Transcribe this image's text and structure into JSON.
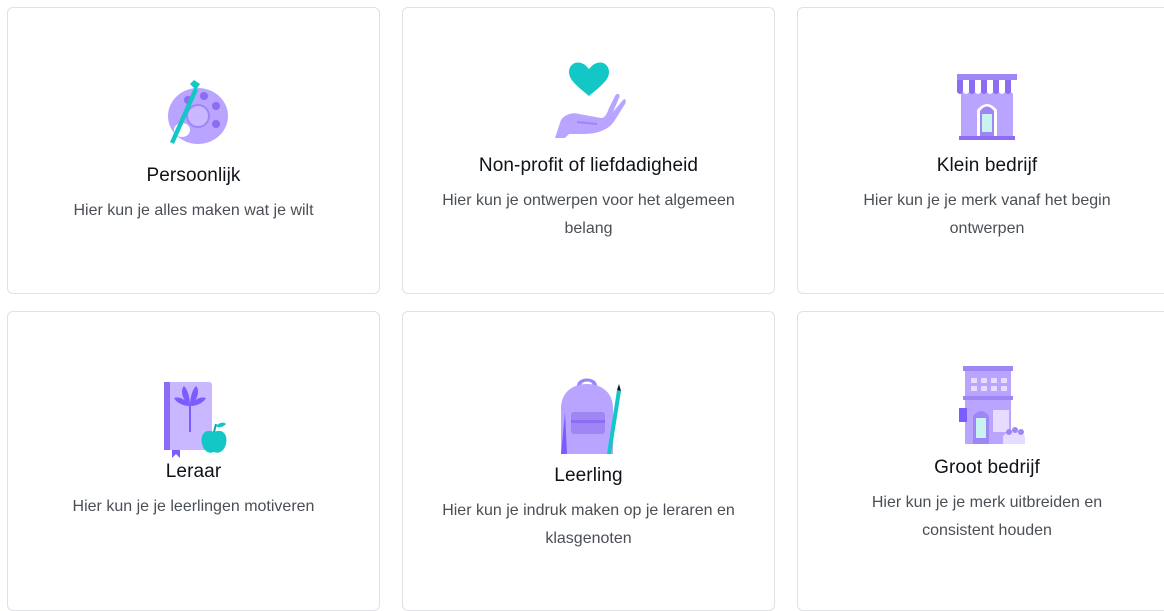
{
  "colors": {
    "purple": "#a78bfa",
    "purple_dark": "#7c5cff",
    "purple_light": "#c9b8ff",
    "teal": "#13c7c7",
    "card_border": "#dfe1e5",
    "title_text": "#0e1318",
    "desc_text": "#4a4f55"
  },
  "cards": [
    {
      "icon": "palette-icon",
      "title": "Persoonlijk",
      "description": "Hier kun je alles maken wat je wilt"
    },
    {
      "icon": "heart-hand-icon",
      "title": "Non-profit of liefdadigheid",
      "description": "Hier kun je ontwerpen voor het algemeen belang"
    },
    {
      "icon": "storefront-icon",
      "title": "Klein bedrijf",
      "description": "Hier kun je je merk vanaf het begin ontwerpen"
    },
    {
      "icon": "book-apple-icon",
      "title": "Leraar",
      "description": "Hier kun je je leerlingen motiveren"
    },
    {
      "icon": "backpack-icon",
      "title": "Leerling",
      "description": "Hier kun je indruk maken op je leraren en klasgenoten"
    },
    {
      "icon": "office-building-icon",
      "title": "Groot bedrijf",
      "description": "Hier kun je je merk uitbreiden en consistent houden"
    }
  ]
}
